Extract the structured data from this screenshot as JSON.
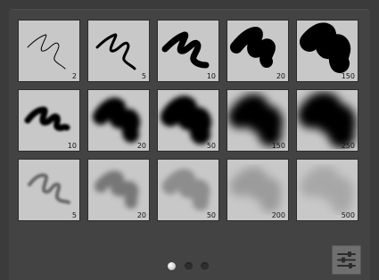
{
  "presets": {
    "row1": [
      {
        "size": "2"
      },
      {
        "size": "5"
      },
      {
        "size": "10"
      },
      {
        "size": "20"
      },
      {
        "size": "150"
      }
    ],
    "row2": [
      {
        "size": "10"
      },
      {
        "size": "20"
      },
      {
        "size": "50"
      },
      {
        "size": "150"
      },
      {
        "size": "250"
      }
    ],
    "row3": [
      {
        "size": "5"
      },
      {
        "size": "20"
      },
      {
        "size": "50"
      },
      {
        "size": "200"
      },
      {
        "size": "500"
      }
    ]
  },
  "pagination": {
    "pages": 3,
    "current": 1
  },
  "icons": {
    "settings": "sliders-icon"
  },
  "colors": {
    "panel": "#434343",
    "tile": "#c8c8c8"
  }
}
